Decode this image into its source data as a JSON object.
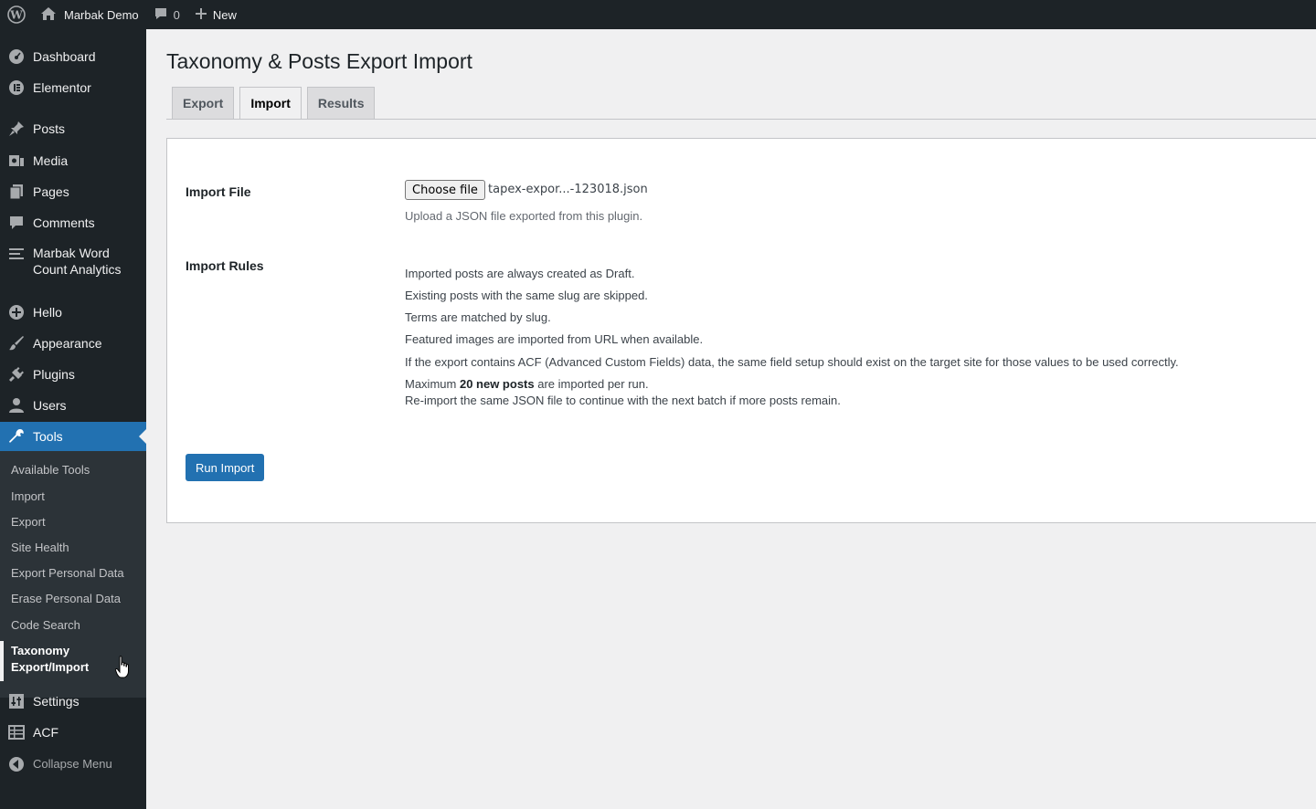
{
  "adminbar": {
    "site_name": "Marbak Demo",
    "comments_count": "0",
    "new_label": "New"
  },
  "sidebar": {
    "items": [
      {
        "label": "Dashboard",
        "icon": "dashboard-icon"
      },
      {
        "label": "Elementor",
        "icon": "elementor-icon"
      },
      {
        "label": "Posts",
        "icon": "pin-icon"
      },
      {
        "label": "Media",
        "icon": "media-icon"
      },
      {
        "label": "Pages",
        "icon": "pages-icon"
      },
      {
        "label": "Comments",
        "icon": "comment-icon"
      },
      {
        "label": "Marbak Word Count Analytics",
        "icon": "list-icon"
      },
      {
        "label": "Hello",
        "icon": "plus-circle-icon"
      },
      {
        "label": "Appearance",
        "icon": "brush-icon"
      },
      {
        "label": "Plugins",
        "icon": "plug-icon"
      },
      {
        "label": "Users",
        "icon": "user-icon"
      },
      {
        "label": "Tools",
        "icon": "wrench-icon"
      },
      {
        "label": "Settings",
        "icon": "sliders-icon"
      },
      {
        "label": "ACF",
        "icon": "table-icon"
      }
    ],
    "submenu": [
      "Available Tools",
      "Import",
      "Export",
      "Site Health",
      "Export Personal Data",
      "Erase Personal Data",
      "Code Search",
      "Taxonomy Export/Import"
    ],
    "collapse_label": "Collapse Menu"
  },
  "page": {
    "title": "Taxonomy & Posts Export Import",
    "tabs": [
      "Export",
      "Import",
      "Results"
    ],
    "active_tab": "Import"
  },
  "form": {
    "import_file_label": "Import File",
    "choose_file_label": "Choose file",
    "file_name": "tapex-expor...-123018.json",
    "file_description": "Upload a JSON file exported from this plugin.",
    "import_rules_label": "Import Rules",
    "rules": [
      "Imported posts are always created as Draft.",
      "Existing posts with the same slug are skipped.",
      "Terms are matched by slug.",
      "Featured images are imported from URL when available.",
      "If the export contains ACF (Advanced Custom Fields) data, the same field setup should exist on the target site for those values to be used correctly."
    ],
    "max_rule_prefix": "Maximum",
    "max_rule_bold": "20 new posts",
    "max_rule_suffix": "are imported per run.",
    "reimport_rule": "Re-import the same JSON file to continue with the next batch if more posts remain.",
    "run_button_label": "Run Import"
  },
  "colors": {
    "adminbar_bg": "#1d2327",
    "accent": "#2271b1",
    "page_bg": "#f0f0f1"
  }
}
